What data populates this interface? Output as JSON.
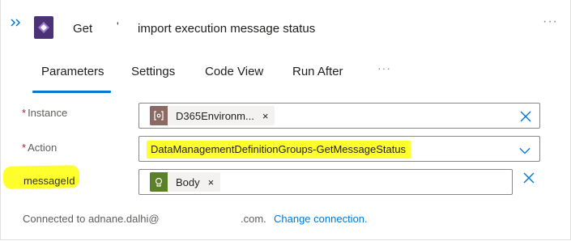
{
  "header": {
    "title_part1": "Get",
    "title_dot": "'",
    "title_part2": "import execution message status",
    "more": "···",
    "expand_icon": "double-chevron-right-icon",
    "app_icon": "power-apps-icon"
  },
  "tabs": [
    {
      "label": "Parameters",
      "selected": true
    },
    {
      "label": "Settings"
    },
    {
      "label": "Code View"
    },
    {
      "label": "Run After"
    }
  ],
  "tabs_more": "···",
  "fields": {
    "instance": {
      "required_mark": "*",
      "label": "Instance",
      "token_label": "D365Environm...",
      "token_close": "×",
      "token_icon": "parameter-icon"
    },
    "action": {
      "required_mark": "*",
      "label": "Action",
      "value": "DataManagementDefinitionGroups-GetMessageStatus"
    },
    "messageid": {
      "label": "messageId",
      "token_label": "Body",
      "token_close": "×",
      "token_icon": "body-output-icon"
    }
  },
  "footer": {
    "connected_text": "Connected to adnane.dalhi@",
    "domain_suffix": ".com.",
    "change_link": "Change connection."
  },
  "colors": {
    "highlight": "#ffff2e",
    "accent_blue": "#0078d4",
    "app_purple": "#4a3275",
    "required_red": "#a4262c"
  }
}
